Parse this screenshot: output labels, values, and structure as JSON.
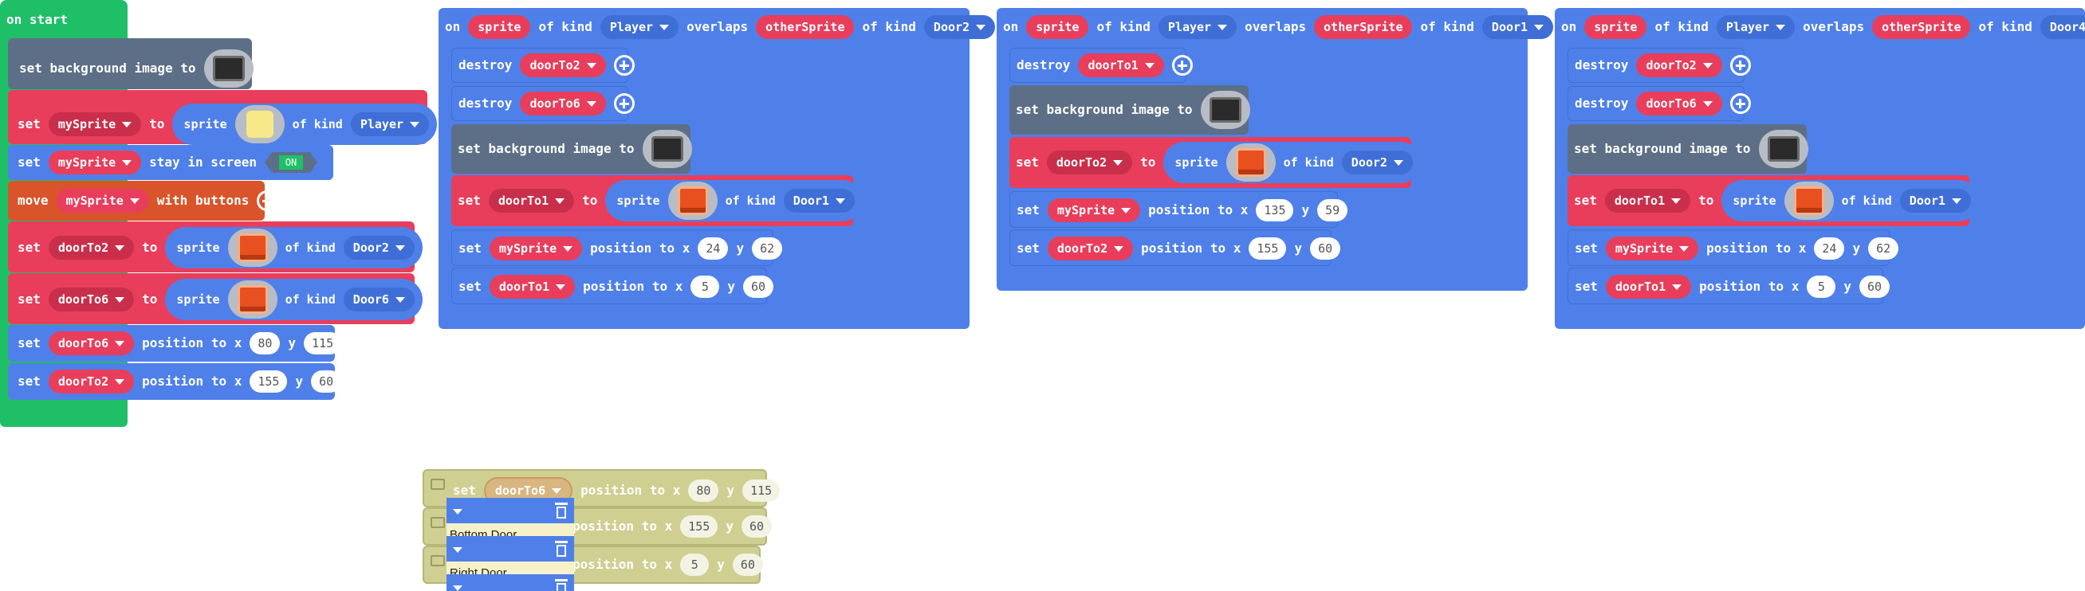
{
  "colors": {
    "event_green": "#1fbf68",
    "sprite_blue": "#4f80e9",
    "variable_pink": "#e83e5c",
    "scene_slate": "#5d6f87",
    "controller_orange": "#d9542a",
    "ghost_olive": "#cfcf92"
  },
  "on_start": {
    "title": "on start",
    "set_bg": "set background image to",
    "set1": {
      "set": "set",
      "var": "mySprite",
      "to": "to",
      "sprite": "sprite",
      "of_kind": "of kind",
      "kind": "Player"
    },
    "set2": {
      "set": "set",
      "var": "mySprite",
      "action": "stay in screen",
      "toggle": "ON"
    },
    "move": {
      "move": "move",
      "var": "mySprite",
      "with": "with buttons"
    },
    "set3": {
      "set": "set",
      "var": "doorTo2",
      "to": "to",
      "sprite": "sprite",
      "of_kind": "of kind",
      "kind": "Door2"
    },
    "set4": {
      "set": "set",
      "var": "doorTo6",
      "to": "to",
      "sprite": "sprite",
      "of_kind": "of kind",
      "kind": "Door6"
    },
    "pos1": {
      "set": "set",
      "var": "doorTo6",
      "label": "position to x",
      "x": "80",
      "y_label": "y",
      "y": "115"
    },
    "pos2": {
      "set": "set",
      "var": "doorTo2",
      "label": "position to x",
      "x": "155",
      "y_label": "y",
      "y": "60"
    }
  },
  "overlap1": {
    "on": "on",
    "sprite": "sprite",
    "of_kind": "of kind",
    "kind": "Player",
    "overlaps": "overlaps",
    "other": "otherSprite",
    "of_kind2": "of kind",
    "kind2": "Door2",
    "destroy1": {
      "label": "destroy",
      "var": "doorTo2"
    },
    "destroy2": {
      "label": "destroy",
      "var": "doorTo6"
    },
    "set_bg": "set background image to",
    "set_sprite": {
      "set": "set",
      "var": "doorTo1",
      "to": "to",
      "sprite": "sprite",
      "of_kind": "of kind",
      "kind": "Door1"
    },
    "pos1": {
      "set": "set",
      "var": "mySprite",
      "label": "position to x",
      "x": "24",
      "y_label": "y",
      "y": "62"
    },
    "pos2": {
      "set": "set",
      "var": "doorTo1",
      "label": "position to x",
      "x": "5",
      "y_label": "y",
      "y": "60"
    }
  },
  "overlap2": {
    "on": "on",
    "sprite": "sprite",
    "of_kind": "of kind",
    "kind": "Player",
    "overlaps": "overlaps",
    "other": "otherSprite",
    "of_kind2": "of kind",
    "kind2": "Door1",
    "destroy1": {
      "label": "destroy",
      "var": "doorTo1"
    },
    "set_bg": "set background image to",
    "set_sprite": {
      "set": "set",
      "var": "doorTo2",
      "to": "to",
      "sprite": "sprite",
      "of_kind": "of kind",
      "kind": "Door2"
    },
    "pos1": {
      "set": "set",
      "var": "mySprite",
      "label": "position to x",
      "x": "135",
      "y_label": "y",
      "y": "59"
    },
    "pos2": {
      "set": "set",
      "var": "doorTo2",
      "label": "position to x",
      "x": "155",
      "y_label": "y",
      "y": "60"
    }
  },
  "overlap3": {
    "on": "on",
    "sprite": "sprite",
    "of_kind": "of kind",
    "kind": "Player",
    "overlaps": "overlaps",
    "other": "otherSprite",
    "of_kind2": "of kind",
    "kind2": "Door4",
    "destroy1": {
      "label": "destroy",
      "var": "doorTo2"
    },
    "destroy2": {
      "label": "destroy",
      "var": "doorTo6"
    },
    "set_bg": "set background image to",
    "set_sprite": {
      "set": "set",
      "var": "doorTo1",
      "to": "to",
      "sprite": "sprite",
      "of_kind": "of kind",
      "kind": "Door1"
    },
    "pos1": {
      "set": "set",
      "var": "mySprite",
      "label": "position to x",
      "x": "24",
      "y_label": "y",
      "y": "62"
    },
    "pos2": {
      "set": "set",
      "var": "doorTo1",
      "label": "position to x",
      "x": "5",
      "y_label": "y",
      "y": "60"
    }
  },
  "drag_ghost": {
    "row1": {
      "set": "set",
      "var": "doorTo6",
      "label": "position to x",
      "x": "80",
      "y_label": "y",
      "y": "115"
    },
    "row2": {
      "label": "position to x",
      "x": "155",
      "y_label": "y",
      "y": "60"
    },
    "row3": {
      "label": "position to x",
      "x": "5",
      "y_label": "y",
      "y": "60"
    },
    "menu_item1": "Bottom Door",
    "menu_item2": "Right Door"
  }
}
